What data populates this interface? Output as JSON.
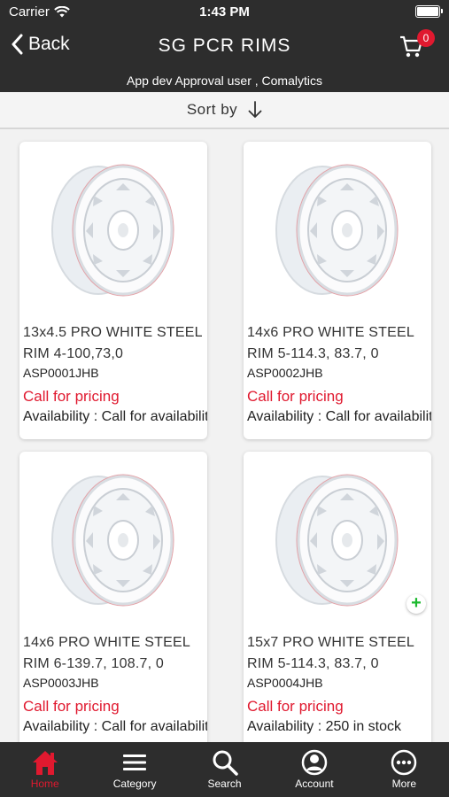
{
  "status_bar": {
    "carrier": "Carrier",
    "time": "1:43 PM"
  },
  "nav": {
    "back_label": "Back",
    "title": "SG PCR RIMS",
    "cart_count": "0",
    "user": "App dev Approval user , Comalytics"
  },
  "sort": {
    "label": "Sort by"
  },
  "products": [
    {
      "name": "13x4.5 PRO WHITE STEEL RIM 4-100,73,0",
      "sku": "ASP0001JHB",
      "price": "Call for pricing",
      "availability": "Availability : Call for availability"
    },
    {
      "name": "14x6 PRO WHITE STEEL RIM 5-114.3, 83.7, 0",
      "sku": "ASP0002JHB",
      "price": "Call for pricing",
      "availability": "Availability : Call for availability"
    },
    {
      "name": "14x6 PRO WHITE STEEL RIM 6-139.7, 108.7, 0",
      "sku": "ASP0003JHB",
      "price": "Call for pricing",
      "availability": "Availability : Call for availability"
    },
    {
      "name": "15x7 PRO WHITE STEEL RIM 5-114.3, 83.7, 0",
      "sku": "ASP0004JHB",
      "price": "Call for pricing",
      "availability": "Availability : 250 in stock"
    }
  ],
  "tabs": [
    {
      "label": "Home",
      "icon": "home-icon"
    },
    {
      "label": "Category",
      "icon": "menu-icon"
    },
    {
      "label": "Search",
      "icon": "search-icon"
    },
    {
      "label": "Account",
      "icon": "account-icon"
    },
    {
      "label": "More",
      "icon": "more-icon"
    }
  ],
  "colors": {
    "bar_bg": "#2d2d2d",
    "accent_red": "#e0192f",
    "add_green": "#1cb92e"
  }
}
